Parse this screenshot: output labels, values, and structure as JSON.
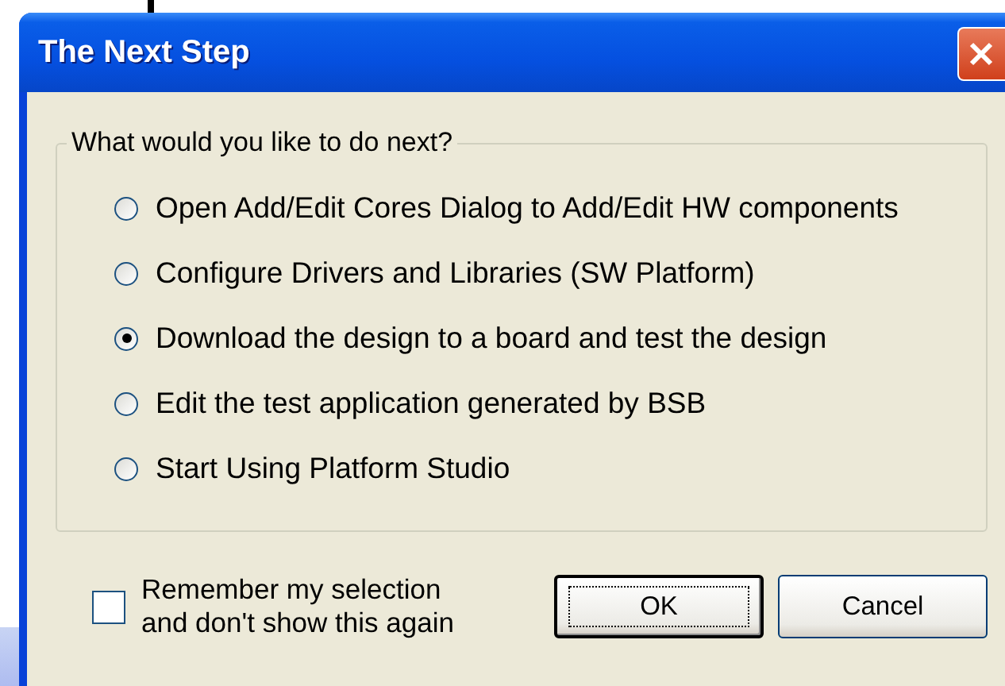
{
  "window": {
    "title": "The Next Step"
  },
  "group": {
    "legend": "What would you like to do next?",
    "options": [
      {
        "label": "Open Add/Edit Cores Dialog to Add/Edit HW components",
        "selected": false
      },
      {
        "label": "Configure Drivers and Libraries (SW Platform)",
        "selected": false
      },
      {
        "label": "Download the design to a board and test the design",
        "selected": true
      },
      {
        "label": "Edit the test application generated by BSB",
        "selected": false
      },
      {
        "label": "Start Using Platform Studio",
        "selected": false
      }
    ]
  },
  "remember": {
    "label": "Remember my selection and don't show this again",
    "checked": false
  },
  "buttons": [
    {
      "label": "OK",
      "default": true
    },
    {
      "label": "Cancel",
      "default": false
    }
  ]
}
